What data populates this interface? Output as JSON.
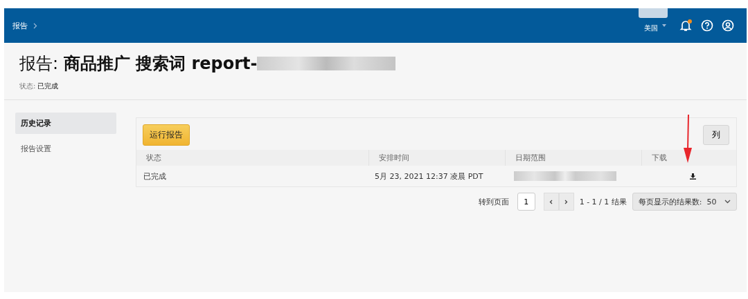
{
  "breadcrumb": [
    {
      "label": "报告"
    }
  ],
  "topbar": {
    "marketplace": "美国",
    "notification_dot": true
  },
  "page": {
    "title_prefix": "报告:",
    "title_bold": "商品推广 搜索词 report-",
    "status_label": "状态:",
    "status_value": "已完成"
  },
  "sidebar": {
    "items": [
      {
        "label": "历史记录",
        "selected": true
      },
      {
        "label": "报告设置",
        "selected": false
      }
    ]
  },
  "toolbar": {
    "run_button": "运行报告",
    "columns_button": "列"
  },
  "table": {
    "columns": [
      "状态",
      "安排时间",
      "日期范围",
      "下载"
    ],
    "rows": [
      {
        "status": "已完成",
        "scheduled": "5月 23, 2021 12:37 凌晨 PDT"
      }
    ]
  },
  "pagination": {
    "goto_label": "转到页面",
    "page_value": "1",
    "range": "1 - 1 / 1 结果",
    "per_page": "每页显示的结果数:  50"
  }
}
